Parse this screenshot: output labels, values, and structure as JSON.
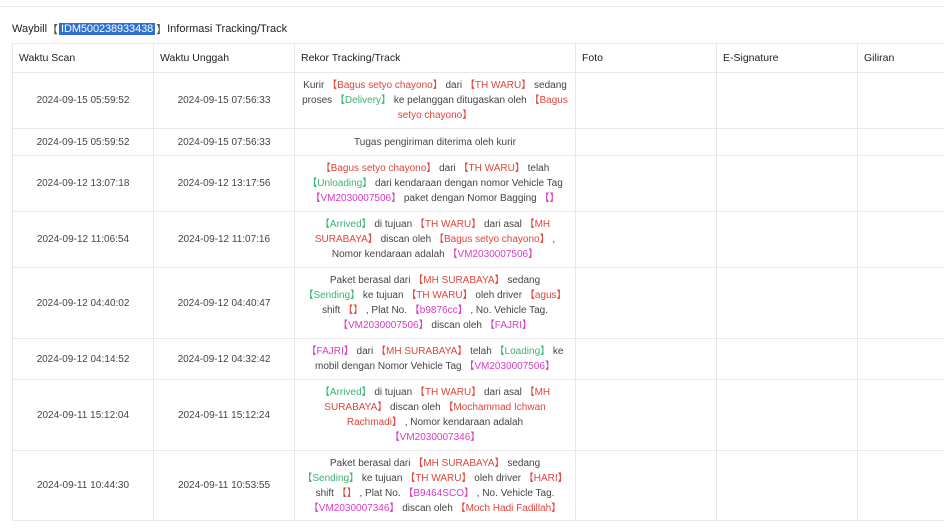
{
  "header": {
    "prefix": "Waybill",
    "bracket_open": "【",
    "waybill": "IDM500238933438",
    "bracket_close": "】",
    "suffix": "Informasi Tracking/Track"
  },
  "columns": [
    "Waktu Scan",
    "Waktu Unggah",
    "Rekor Tracking/Track",
    "Foto",
    "E-Signature",
    "Giliran"
  ],
  "rows": [
    {
      "scan": "2024-09-15 05:59:52",
      "upload": "2024-09-15 07:56:33",
      "segments": [
        {
          "t": "Kurir "
        },
        {
          "t": "【Bagus setyo chayono】",
          "c": "r"
        },
        {
          "t": " dari "
        },
        {
          "t": "【TH WARU】",
          "c": "r"
        },
        {
          "t": " sedang proses "
        },
        {
          "t": "【Delivery】",
          "c": "g"
        },
        {
          "t": " ke pelanggan ditugaskan oleh "
        },
        {
          "t": "【Bagus setyo chayono】",
          "c": "r"
        }
      ]
    },
    {
      "scan": "2024-09-15 05:59:52",
      "upload": "2024-09-15 07:56:33",
      "segments": [
        {
          "t": "Tugas pengiriman diterima oleh kurir"
        }
      ]
    },
    {
      "scan": "2024-09-12 13:07:18",
      "upload": "2024-09-12 13:17:56",
      "segments": [
        {
          "t": "【Bagus setyo chayono】",
          "c": "r"
        },
        {
          "t": " dari "
        },
        {
          "t": "【TH WARU】",
          "c": "r"
        },
        {
          "t": " telah "
        },
        {
          "t": "【Unloading】",
          "c": "g"
        },
        {
          "t": " dari kendaraan dengan nomor Vehicle Tag "
        },
        {
          "t": "【VM2030007506】",
          "c": "m"
        },
        {
          "t": " paket dengan Nomor Bagging "
        },
        {
          "t": "【】",
          "c": "m"
        }
      ]
    },
    {
      "scan": "2024-09-12 11:06:54",
      "upload": "2024-09-12 11:07:16",
      "segments": [
        {
          "t": "【Arrived】",
          "c": "g"
        },
        {
          "t": " di tujuan "
        },
        {
          "t": "【TH WARU】",
          "c": "r"
        },
        {
          "t": " dari asal "
        },
        {
          "t": "【MH SURABAYA】",
          "c": "r"
        },
        {
          "t": " discan oleh "
        },
        {
          "t": "【Bagus setyo chayono】",
          "c": "r"
        },
        {
          "t": " , Nomor kendaraan adalah "
        },
        {
          "t": "【VM2030007506】",
          "c": "m"
        }
      ]
    },
    {
      "scan": "2024-09-12 04:40:02",
      "upload": "2024-09-12 04:40:47",
      "segments": [
        {
          "t": "Paket berasal dari "
        },
        {
          "t": "【MH SURABAYA】",
          "c": "r"
        },
        {
          "t": " sedang "
        },
        {
          "t": "【Sending】",
          "c": "g"
        },
        {
          "t": " ke tujuan "
        },
        {
          "t": "【TH WARU】",
          "c": "r"
        },
        {
          "t": " oleh driver "
        },
        {
          "t": "【agus】",
          "c": "r"
        },
        {
          "t": " shift "
        },
        {
          "t": "【】",
          "c": "r"
        },
        {
          "t": " , Plat No. "
        },
        {
          "t": "【b9876cc】",
          "c": "m"
        },
        {
          "t": " , No. Vehicle Tag. "
        },
        {
          "t": "【VM2030007506】",
          "c": "m"
        },
        {
          "t": " discan oleh "
        },
        {
          "t": "【FAJRI】",
          "c": "m"
        }
      ]
    },
    {
      "scan": "2024-09-12 04:14:52",
      "upload": "2024-09-12 04:32:42",
      "segments": [
        {
          "t": "【FAJRI】",
          "c": "m"
        },
        {
          "t": " dari "
        },
        {
          "t": "【MH SURABAYA】",
          "c": "r"
        },
        {
          "t": " telah "
        },
        {
          "t": "【Loading】",
          "c": "g"
        },
        {
          "t": " ke mobil dengan Nomor Vehicle Tag "
        },
        {
          "t": "【VM2030007506】",
          "c": "m"
        }
      ]
    },
    {
      "scan": "2024-09-11 15:12:04",
      "upload": "2024-09-11 15:12:24",
      "segments": [
        {
          "t": "【Arrived】",
          "c": "g"
        },
        {
          "t": " di tujuan "
        },
        {
          "t": "【TH WARU】",
          "c": "r"
        },
        {
          "t": " dari asal "
        },
        {
          "t": "【MH SURABAYA】",
          "c": "r"
        },
        {
          "t": " discan oleh "
        },
        {
          "t": "【Mochammad Ichwan Rachmadi】",
          "c": "r"
        },
        {
          "t": " , Nomor kendaraan adalah "
        },
        {
          "t": "【VM2030007346】",
          "c": "m"
        }
      ]
    },
    {
      "scan": "2024-09-11 10:44:30",
      "upload": "2024-09-11 10:53:55",
      "segments": [
        {
          "t": "Paket berasal dari "
        },
        {
          "t": "【MH SURABAYA】",
          "c": "r"
        },
        {
          "t": " sedang "
        },
        {
          "t": "【Sending】",
          "c": "g"
        },
        {
          "t": " ke tujuan "
        },
        {
          "t": "【TH WARU】",
          "c": "r"
        },
        {
          "t": " oleh driver "
        },
        {
          "t": "【HARI】",
          "c": "r"
        },
        {
          "t": " shift "
        },
        {
          "t": "【】",
          "c": "r"
        },
        {
          "t": " , Plat No. "
        },
        {
          "t": "【B9464SCO】",
          "c": "m"
        },
        {
          "t": " , No. Vehicle Tag. "
        },
        {
          "t": "【VM2030007346】",
          "c": "m"
        },
        {
          "t": " discan oleh "
        },
        {
          "t": "【Moch Hadi Fadillah】",
          "c": "r"
        }
      ]
    }
  ],
  "colors": {
    "red": "#e0453a",
    "green": "#3cb371",
    "magenta": "#d63cc4",
    "selection": "#2f6fd0"
  }
}
